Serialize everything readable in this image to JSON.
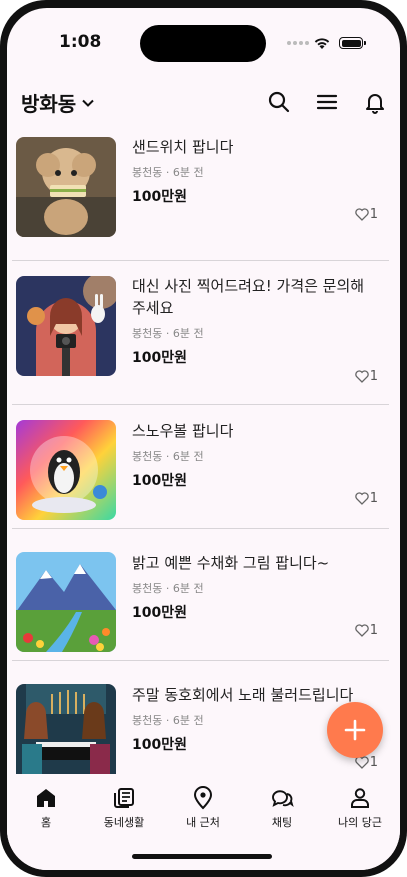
{
  "status": {
    "time": "1:08"
  },
  "header": {
    "location": "방화동"
  },
  "listings": [
    {
      "title": "샌드위치 팝니다",
      "meta": "봉천동 · 6분 전",
      "price": "100만원",
      "likes": "1"
    },
    {
      "title": "대신 사진 찍어드려요! 가격은 문의해 주세요",
      "meta": "봉천동 · 6분 전",
      "price": "100만원",
      "likes": "1"
    },
    {
      "title": "스노우볼 팝니다",
      "meta": "봉천동 · 6분 전",
      "price": "100만원",
      "likes": "1"
    },
    {
      "title": "밝고 예쁜 수채화 그림 팝니다~",
      "meta": "봉천동 · 6분 전",
      "price": "100만원",
      "likes": "1"
    },
    {
      "title": "주말 동호회에서 노래 불러드립니다",
      "meta": "봉천동 · 6분 전",
      "price": "100만원",
      "likes": "1"
    }
  ],
  "nav": [
    {
      "label": "홈",
      "icon": "home-icon"
    },
    {
      "label": "동네생활",
      "icon": "news-icon"
    },
    {
      "label": "내 근처",
      "icon": "location-pin-icon"
    },
    {
      "label": "채팅",
      "icon": "chat-bubbles-icon"
    },
    {
      "label": "나의 당근",
      "icon": "person-icon"
    }
  ],
  "colors": {
    "accent": "#ff7a4d",
    "background": "#fdf7fb"
  }
}
